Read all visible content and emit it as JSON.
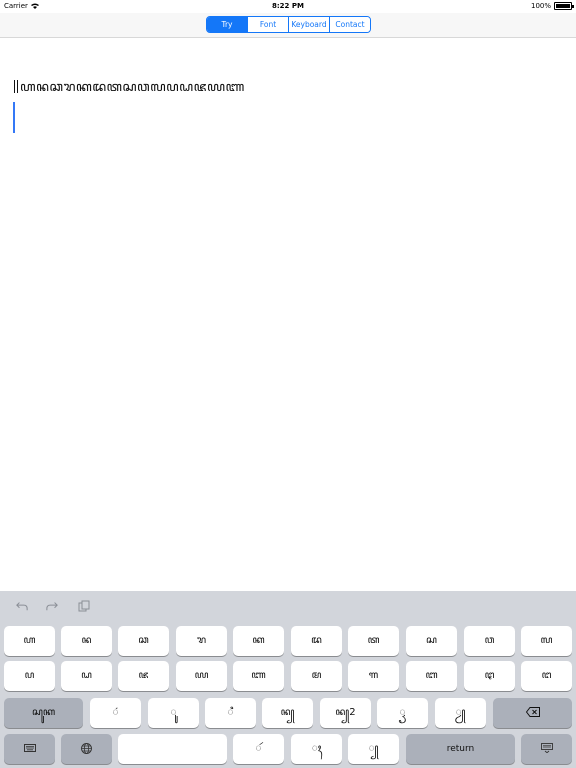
{
  "status": {
    "carrier": "Carrier",
    "time": "8:22 PM",
    "battery": "100%"
  },
  "tabs": [
    {
      "label": "Try",
      "active": true
    },
    {
      "label": "Font",
      "active": false
    },
    {
      "label": "Keyboard",
      "active": false
    },
    {
      "label": "Contact",
      "active": false
    }
  ],
  "editor": {
    "text": "ꦲꦤꦕꦫꦏꦢꦠꦱꦮꦭꦥꦝꦗꦪꦚ"
  },
  "keyboard": {
    "toolbar_icons": [
      "undo-icon",
      "redo-icon",
      "paste-icon"
    ],
    "row1": [
      "ꦲ",
      "ꦤ",
      "ꦕ",
      "ꦫ",
      "ꦏ",
      "ꦢ",
      "ꦠ",
      "ꦱ",
      "ꦮ",
      "ꦭ"
    ],
    "row2": [
      "ꦥ",
      "ꦝ",
      "ꦗ",
      "ꦪ",
      "ꦚ",
      "ꦩ",
      "ꦒ",
      "ꦧ",
      "ꦛ",
      "ꦔ"
    ],
    "row3": {
      "shift": "ꦱꦸꦏ",
      "keys": [
        "ꦁ",
        "ꦸ",
        "ꦶ",
        "ꦤ꧀",
        "ꦤ꧀2",
        "ꦽ",
        "ꦾ"
      ],
      "delete_icon": "backspace-icon"
    },
    "row4": {
      "keyboard_icon": "keyboard-icon",
      "globe_icon": "globe-icon",
      "space": "",
      "keys": [
        "ꦂ",
        "ꦃ",
        "꧀"
      ],
      "return": "return",
      "dismiss_icon": "hide-keyboard-icon"
    }
  },
  "colors": {
    "accent": "#1477f8",
    "caret": "#3478f6",
    "keyboard_bg": "#d2d5db"
  }
}
